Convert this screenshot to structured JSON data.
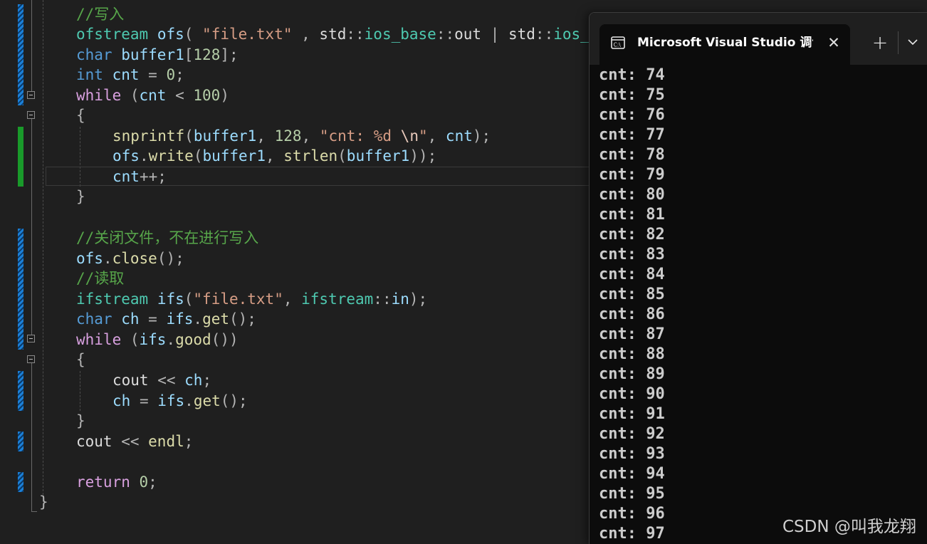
{
  "editor": {
    "lines": [
      {
        "tokens": [
          {
            "t": "//写入",
            "c": "comment"
          }
        ]
      },
      {
        "tokens": [
          {
            "t": "ofstream",
            "c": "type"
          },
          {
            "t": " ",
            "c": "plain"
          },
          {
            "t": "ofs",
            "c": "var"
          },
          {
            "t": "( ",
            "c": "punct"
          },
          {
            "t": "\"file.txt\"",
            "c": "str"
          },
          {
            "t": " , ",
            "c": "punct"
          },
          {
            "t": "std",
            "c": "plain"
          },
          {
            "t": "::",
            "c": "punct"
          },
          {
            "t": "ios_base",
            "c": "type"
          },
          {
            "t": "::",
            "c": "punct"
          },
          {
            "t": "out",
            "c": "plain"
          },
          {
            "t": " | ",
            "c": "punct"
          },
          {
            "t": "std",
            "c": "plain"
          },
          {
            "t": "::",
            "c": "punct"
          },
          {
            "t": "ios_",
            "c": "type"
          }
        ]
      },
      {
        "tokens": [
          {
            "t": "char",
            "c": "kw"
          },
          {
            "t": " ",
            "c": "plain"
          },
          {
            "t": "buffer1",
            "c": "var"
          },
          {
            "t": "[",
            "c": "punct"
          },
          {
            "t": "128",
            "c": "num"
          },
          {
            "t": "];",
            "c": "punct"
          }
        ]
      },
      {
        "tokens": [
          {
            "t": "int",
            "c": "kw"
          },
          {
            "t": " ",
            "c": "plain"
          },
          {
            "t": "cnt",
            "c": "var"
          },
          {
            "t": " = ",
            "c": "punct"
          },
          {
            "t": "0",
            "c": "num"
          },
          {
            "t": ";",
            "c": "punct"
          }
        ]
      },
      {
        "tokens": [
          {
            "t": "while",
            "c": "ctrl"
          },
          {
            "t": " (",
            "c": "punct"
          },
          {
            "t": "cnt",
            "c": "var"
          },
          {
            "t": " < ",
            "c": "punct"
          },
          {
            "t": "100",
            "c": "num"
          },
          {
            "t": ")",
            "c": "punct"
          }
        ]
      },
      {
        "tokens": [
          {
            "t": "{",
            "c": "punct"
          }
        ]
      },
      {
        "tokens": [
          {
            "t": "snprintf",
            "c": "fn"
          },
          {
            "t": "(",
            "c": "punct"
          },
          {
            "t": "buffer1",
            "c": "var"
          },
          {
            "t": ", ",
            "c": "punct"
          },
          {
            "t": "128",
            "c": "num"
          },
          {
            "t": ", ",
            "c": "punct"
          },
          {
            "t": "\"cnt: ",
            "c": "str"
          },
          {
            "t": "%d",
            "c": "str"
          },
          {
            "t": " ",
            "c": "str"
          },
          {
            "t": "\\n",
            "c": "esc"
          },
          {
            "t": "\"",
            "c": "str"
          },
          {
            "t": ", ",
            "c": "punct"
          },
          {
            "t": "cnt",
            "c": "var"
          },
          {
            "t": ");",
            "c": "punct"
          }
        ]
      },
      {
        "tokens": [
          {
            "t": "ofs",
            "c": "var"
          },
          {
            "t": ".",
            "c": "punct"
          },
          {
            "t": "write",
            "c": "fn"
          },
          {
            "t": "(",
            "c": "punct"
          },
          {
            "t": "buffer1",
            "c": "var"
          },
          {
            "t": ", ",
            "c": "punct"
          },
          {
            "t": "strlen",
            "c": "fn"
          },
          {
            "t": "(",
            "c": "punct"
          },
          {
            "t": "buffer1",
            "c": "var"
          },
          {
            "t": "));",
            "c": "punct"
          }
        ]
      },
      {
        "tokens": [
          {
            "t": "cnt",
            "c": "var"
          },
          {
            "t": "++;",
            "c": "punct"
          }
        ]
      },
      {
        "tokens": [
          {
            "t": "}",
            "c": "punct"
          }
        ]
      },
      {
        "tokens": []
      },
      {
        "tokens": [
          {
            "t": "//关闭文件，不在进行写入",
            "c": "comment"
          }
        ]
      },
      {
        "tokens": [
          {
            "t": "ofs",
            "c": "var"
          },
          {
            "t": ".",
            "c": "punct"
          },
          {
            "t": "close",
            "c": "fn"
          },
          {
            "t": "();",
            "c": "punct"
          }
        ]
      },
      {
        "tokens": [
          {
            "t": "//读取",
            "c": "comment"
          }
        ]
      },
      {
        "tokens": [
          {
            "t": "ifstream",
            "c": "type"
          },
          {
            "t": " ",
            "c": "plain"
          },
          {
            "t": "ifs",
            "c": "var"
          },
          {
            "t": "(",
            "c": "punct"
          },
          {
            "t": "\"file.txt\"",
            "c": "str"
          },
          {
            "t": ", ",
            "c": "punct"
          },
          {
            "t": "ifstream",
            "c": "type"
          },
          {
            "t": "::",
            "c": "punct"
          },
          {
            "t": "in",
            "c": "var"
          },
          {
            "t": ");",
            "c": "punct"
          }
        ]
      },
      {
        "tokens": [
          {
            "t": "char",
            "c": "kw"
          },
          {
            "t": " ",
            "c": "plain"
          },
          {
            "t": "ch",
            "c": "var"
          },
          {
            "t": " = ",
            "c": "punct"
          },
          {
            "t": "ifs",
            "c": "var"
          },
          {
            "t": ".",
            "c": "punct"
          },
          {
            "t": "get",
            "c": "fn"
          },
          {
            "t": "();",
            "c": "punct"
          }
        ]
      },
      {
        "tokens": [
          {
            "t": "while",
            "c": "ctrl"
          },
          {
            "t": " (",
            "c": "punct"
          },
          {
            "t": "ifs",
            "c": "var"
          },
          {
            "t": ".",
            "c": "punct"
          },
          {
            "t": "good",
            "c": "fn"
          },
          {
            "t": "())",
            "c": "punct"
          }
        ]
      },
      {
        "tokens": [
          {
            "t": "{",
            "c": "punct"
          }
        ]
      },
      {
        "tokens": [
          {
            "t": "cout",
            "c": "plain"
          },
          {
            "t": " << ",
            "c": "punct"
          },
          {
            "t": "ch",
            "c": "var"
          },
          {
            "t": ";",
            "c": "punct"
          }
        ]
      },
      {
        "tokens": [
          {
            "t": "ch",
            "c": "var"
          },
          {
            "t": " = ",
            "c": "punct"
          },
          {
            "t": "ifs",
            "c": "var"
          },
          {
            "t": ".",
            "c": "punct"
          },
          {
            "t": "get",
            "c": "fn"
          },
          {
            "t": "();",
            "c": "punct"
          }
        ]
      },
      {
        "tokens": [
          {
            "t": "}",
            "c": "punct"
          }
        ]
      },
      {
        "tokens": [
          {
            "t": "cout",
            "c": "plain"
          },
          {
            "t": " << ",
            "c": "punct"
          },
          {
            "t": "endl",
            "c": "fn"
          },
          {
            "t": ";",
            "c": "punct"
          }
        ]
      },
      {
        "tokens": []
      },
      {
        "tokens": [
          {
            "t": "return",
            "c": "ctrl"
          },
          {
            "t": " ",
            "c": "plain"
          },
          {
            "t": "0",
            "c": "num"
          },
          {
            "t": ";",
            "c": "punct"
          }
        ]
      },
      {
        "tokens": [
          {
            "t": "}",
            "c": "punct"
          }
        ]
      }
    ]
  },
  "terminal": {
    "tab_title": "Microsoft Visual Studio 调试控制台",
    "close_glyph": "✕",
    "new_tab_glyph": "+",
    "output": [
      "cnt: 74",
      "cnt: 75",
      "cnt: 76",
      "cnt: 77",
      "cnt: 78",
      "cnt: 79",
      "cnt: 80",
      "cnt: 81",
      "cnt: 82",
      "cnt: 83",
      "cnt: 84",
      "cnt: 85",
      "cnt: 86",
      "cnt: 87",
      "cnt: 88",
      "cnt: 89",
      "cnt: 90",
      "cnt: 91",
      "cnt: 92",
      "cnt: 93",
      "cnt: 94",
      "cnt: 95",
      "cnt: 96",
      "cnt: 97"
    ]
  },
  "watermark": "CSDN @叫我龙翔",
  "colors": {
    "editor_bg": "#1f1f1f",
    "terminal_bg": "#0c0c0c",
    "change_saved": "#1b7fd6",
    "change_unsaved": "#199a2a",
    "comment": "#57a64a",
    "keyword": "#569cd6",
    "control": "#d8a0df",
    "type": "#4ec9b0",
    "variable": "#9cdcfe",
    "function": "#dcdcaa",
    "number": "#b5cea8",
    "string": "#d69d85"
  },
  "icons": [
    "console-app-icon",
    "close-icon",
    "add-tab-icon",
    "chevron-down-icon",
    "fold-collapse-icon"
  ]
}
